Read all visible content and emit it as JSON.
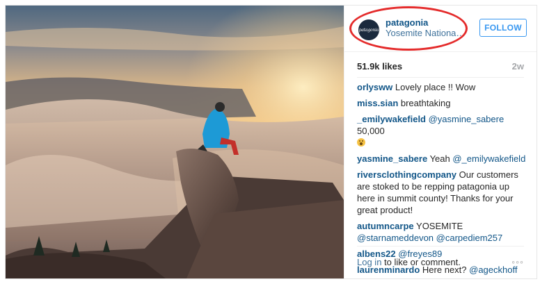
{
  "post": {
    "username": "patagonia",
    "avatar_text": "patagonia",
    "location": "Yosemite National Park",
    "follow_label": "FOLLOW",
    "likes": "51.9k likes",
    "age": "2w"
  },
  "comments": [
    {
      "user": "orlysww",
      "text": " Lovely place !! Wow"
    },
    {
      "user": "miss.sian",
      "text": " breathtaking"
    },
    {
      "user": "_emilywakefield",
      "mention": " @yasmine_sabere",
      "text": " 50,000 ",
      "emoji": "astonished-face"
    },
    {
      "user": "yasmine_sabere",
      "text": " Yeah ",
      "mention_after": "@_emilywakefield"
    },
    {
      "user": "riversclothingcompany",
      "text": " Our customers are stoked to be repping patagonia up here in summit county! Thanks for your great product!"
    },
    {
      "user": "autumncarpe",
      "text": " YOSEMITE ",
      "mention_after": "@starnameddevon @carpediem257"
    },
    {
      "user": "albens22",
      "text": " ",
      "mention_after": "@freyes89"
    },
    {
      "user": "laurenminardo",
      "text": " Here next? ",
      "mention_after": "@ageckhoff"
    }
  ],
  "footer": {
    "login_link": "Log in",
    "login_rest": " to like or comment.",
    "more_icon": "◦◦◦"
  },
  "colors": {
    "highlight": "#e42b2b",
    "link": "#125688",
    "follow": "#3897f0"
  }
}
